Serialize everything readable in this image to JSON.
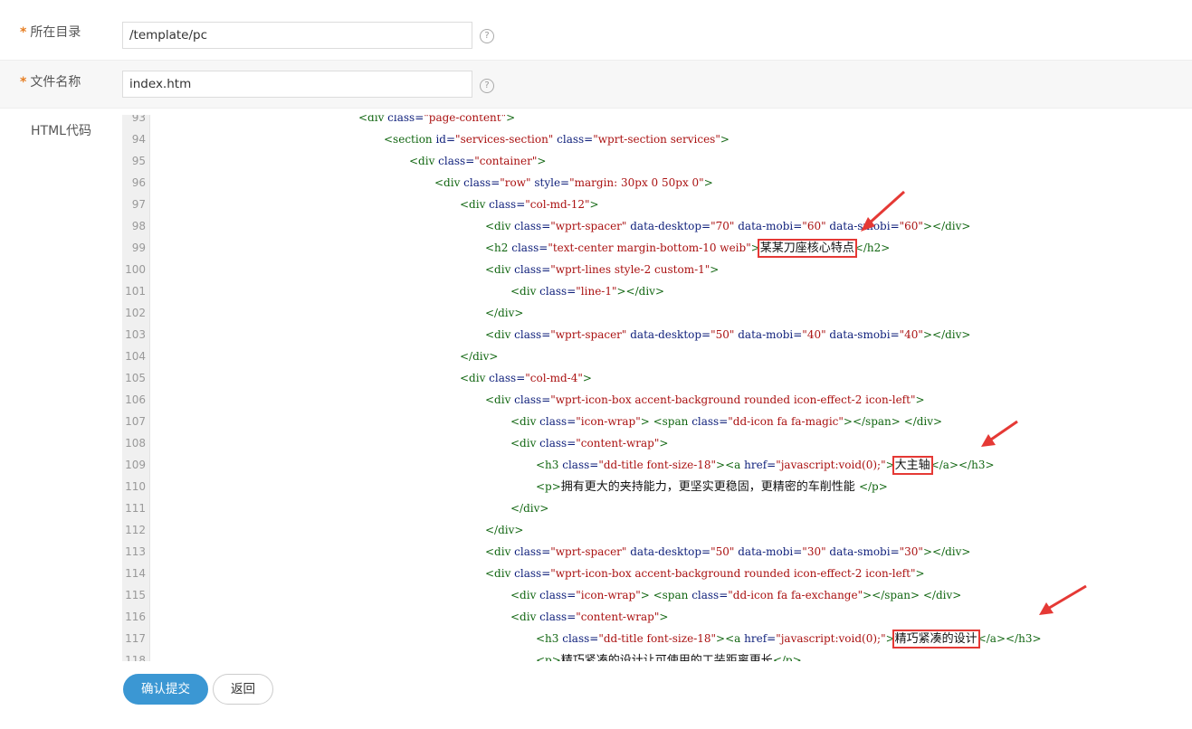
{
  "form": {
    "directory": {
      "label": "所在目录",
      "required": "*",
      "value": "/template/pc",
      "help": "?"
    },
    "filename": {
      "label": "文件名称",
      "required": "*",
      "value": "index.htm",
      "help": "?"
    },
    "html_code_label": "HTML代码"
  },
  "editor": {
    "lines": [
      {
        "num": "93",
        "indent": 1,
        "parts": [
          [
            "tag",
            "<div "
          ],
          [
            "attr",
            "class="
          ],
          [
            "str",
            "\"page-content\""
          ],
          [
            "tag",
            ">"
          ]
        ]
      },
      {
        "num": "94",
        "indent": 2,
        "parts": [
          [
            "tag",
            "<section "
          ],
          [
            "attr",
            "id="
          ],
          [
            "str",
            "\"services-section\""
          ],
          [
            "attr",
            " class="
          ],
          [
            "str",
            "\"wprt-section services\""
          ],
          [
            "tag",
            ">"
          ]
        ]
      },
      {
        "num": "95",
        "indent": 3,
        "parts": [
          [
            "tag",
            "<div "
          ],
          [
            "attr",
            "class="
          ],
          [
            "str",
            "\"container\""
          ],
          [
            "tag",
            ">"
          ]
        ]
      },
      {
        "num": "96",
        "indent": 4,
        "parts": [
          [
            "tag",
            "<div "
          ],
          [
            "attr",
            "class="
          ],
          [
            "str",
            "\"row\""
          ],
          [
            "attr",
            " style="
          ],
          [
            "str",
            "\"margin: 30px 0 50px 0\""
          ],
          [
            "tag",
            ">"
          ]
        ]
      },
      {
        "num": "97",
        "indent": 5,
        "parts": [
          [
            "tag",
            "<div "
          ],
          [
            "attr",
            "class="
          ],
          [
            "str",
            "\"col-md-12\""
          ],
          [
            "tag",
            ">"
          ]
        ]
      },
      {
        "num": "98",
        "indent": 6,
        "parts": [
          [
            "tag",
            "<div "
          ],
          [
            "attr",
            "class="
          ],
          [
            "str",
            "\"wprt-spacer\""
          ],
          [
            "attr",
            " data-desktop="
          ],
          [
            "str",
            "\"70\""
          ],
          [
            "attr",
            " data-mobi="
          ],
          [
            "str",
            "\"60\""
          ],
          [
            "attr",
            " data-smobi="
          ],
          [
            "str",
            "\"60\""
          ],
          [
            "tag",
            "></div>"
          ]
        ]
      },
      {
        "num": "99",
        "indent": 6,
        "parts": [
          [
            "tag",
            "<h2 "
          ],
          [
            "attr",
            "class="
          ],
          [
            "str",
            "\"text-center margin-bottom-10 weib\""
          ],
          [
            "tag",
            ">"
          ],
          [
            "hl",
            "某某刀座核心特点"
          ],
          [
            "tag",
            "</h2>"
          ]
        ]
      },
      {
        "num": "100",
        "indent": 6,
        "parts": [
          [
            "tag",
            "<div "
          ],
          [
            "attr",
            "class="
          ],
          [
            "str",
            "\"wprt-lines style-2 custom-1\""
          ],
          [
            "tag",
            ">"
          ]
        ]
      },
      {
        "num": "101",
        "indent": 7,
        "parts": [
          [
            "tag",
            "<div "
          ],
          [
            "attr",
            "class="
          ],
          [
            "str",
            "\"line-1\""
          ],
          [
            "tag",
            "></div>"
          ]
        ]
      },
      {
        "num": "102",
        "indent": 6,
        "parts": [
          [
            "tag",
            "</div>"
          ]
        ]
      },
      {
        "num": "103",
        "indent": 6,
        "parts": [
          [
            "tag",
            "<div "
          ],
          [
            "attr",
            "class="
          ],
          [
            "str",
            "\"wprt-spacer\""
          ],
          [
            "attr",
            " data-desktop="
          ],
          [
            "str",
            "\"50\""
          ],
          [
            "attr",
            " data-mobi="
          ],
          [
            "str",
            "\"40\""
          ],
          [
            "attr",
            " data-smobi="
          ],
          [
            "str",
            "\"40\""
          ],
          [
            "tag",
            "></div>"
          ]
        ]
      },
      {
        "num": "104",
        "indent": 5,
        "parts": [
          [
            "tag",
            "</div>"
          ]
        ]
      },
      {
        "num": "105",
        "indent": 5,
        "parts": [
          [
            "tag",
            "<div "
          ],
          [
            "attr",
            "class="
          ],
          [
            "str",
            "\"col-md-4\""
          ],
          [
            "tag",
            ">"
          ]
        ]
      },
      {
        "num": "106",
        "indent": 6,
        "parts": [
          [
            "tag",
            "<div "
          ],
          [
            "attr",
            "class="
          ],
          [
            "str",
            "\"wprt-icon-box accent-background rounded icon-effect-2 icon-left\""
          ],
          [
            "tag",
            ">"
          ]
        ]
      },
      {
        "num": "107",
        "indent": 7,
        "parts": [
          [
            "tag",
            "<div "
          ],
          [
            "attr",
            "class="
          ],
          [
            "str",
            "\"icon-wrap\""
          ],
          [
            "tag",
            "> <span "
          ],
          [
            "attr",
            "class="
          ],
          [
            "str",
            "\"dd-icon fa fa-magic\""
          ],
          [
            "tag",
            "></span> </div>"
          ]
        ]
      },
      {
        "num": "108",
        "indent": 7,
        "parts": [
          [
            "tag",
            "<div "
          ],
          [
            "attr",
            "class="
          ],
          [
            "str",
            "\"content-wrap\""
          ],
          [
            "tag",
            ">"
          ]
        ]
      },
      {
        "num": "109",
        "indent": 8,
        "parts": [
          [
            "tag",
            "<h3 "
          ],
          [
            "attr",
            "class="
          ],
          [
            "str",
            "\"dd-title font-size-18\""
          ],
          [
            "tag",
            "><a "
          ],
          [
            "attr",
            "href="
          ],
          [
            "str",
            "\"javascript:void(0);\""
          ],
          [
            "tag",
            ">"
          ],
          [
            "hl",
            "大主轴"
          ],
          [
            "tag",
            "</a></h3>"
          ]
        ]
      },
      {
        "num": "110",
        "indent": 8,
        "parts": [
          [
            "tag",
            "<p>"
          ],
          [
            "cjk",
            "拥有更大的夹持能力，更坚实更稳固，更精密的车削性能 "
          ],
          [
            "tag",
            "</p>"
          ]
        ]
      },
      {
        "num": "111",
        "indent": 7,
        "parts": [
          [
            "tag",
            "</div>"
          ]
        ]
      },
      {
        "num": "112",
        "indent": 6,
        "parts": [
          [
            "tag",
            "</div>"
          ]
        ]
      },
      {
        "num": "113",
        "indent": 6,
        "parts": [
          [
            "tag",
            "<div "
          ],
          [
            "attr",
            "class="
          ],
          [
            "str",
            "\"wprt-spacer\""
          ],
          [
            "attr",
            " data-desktop="
          ],
          [
            "str",
            "\"50\""
          ],
          [
            "attr",
            " data-mobi="
          ],
          [
            "str",
            "\"30\""
          ],
          [
            "attr",
            " data-smobi="
          ],
          [
            "str",
            "\"30\""
          ],
          [
            "tag",
            "></div>"
          ]
        ]
      },
      {
        "num": "114",
        "indent": 6,
        "parts": [
          [
            "tag",
            "<div "
          ],
          [
            "attr",
            "class="
          ],
          [
            "str",
            "\"wprt-icon-box accent-background rounded icon-effect-2 icon-left\""
          ],
          [
            "tag",
            ">"
          ]
        ]
      },
      {
        "num": "115",
        "indent": 7,
        "parts": [
          [
            "tag",
            "<div "
          ],
          [
            "attr",
            "class="
          ],
          [
            "str",
            "\"icon-wrap\""
          ],
          [
            "tag",
            "> <span "
          ],
          [
            "attr",
            "class="
          ],
          [
            "str",
            "\"dd-icon fa fa-exchange\""
          ],
          [
            "tag",
            "></span> </div>"
          ]
        ]
      },
      {
        "num": "116",
        "indent": 7,
        "parts": [
          [
            "tag",
            "<div "
          ],
          [
            "attr",
            "class="
          ],
          [
            "str",
            "\"content-wrap\""
          ],
          [
            "tag",
            ">"
          ]
        ]
      },
      {
        "num": "117",
        "indent": 8,
        "parts": [
          [
            "tag",
            "<h3 "
          ],
          [
            "attr",
            "class="
          ],
          [
            "str",
            "\"dd-title font-size-18\""
          ],
          [
            "tag",
            "><a "
          ],
          [
            "attr",
            "href="
          ],
          [
            "str",
            "\"javascript:void(0);\""
          ],
          [
            "tag",
            ">"
          ],
          [
            "hl",
            "精巧紧凑的设计"
          ],
          [
            "tag",
            "</a></h3>"
          ]
        ]
      },
      {
        "num": "118",
        "indent": 8,
        "parts": [
          [
            "tag",
            "<p>"
          ],
          [
            "cjk",
            "精巧紧凑的设计让可使用的工装距离更长"
          ],
          [
            "tag",
            "</p>"
          ]
        ]
      }
    ]
  },
  "buttons": {
    "submit": "确认提交",
    "back": "返回"
  },
  "colors": {
    "accent": "#3b97d3",
    "highlight": "#e53935",
    "required": "#e67e22"
  }
}
